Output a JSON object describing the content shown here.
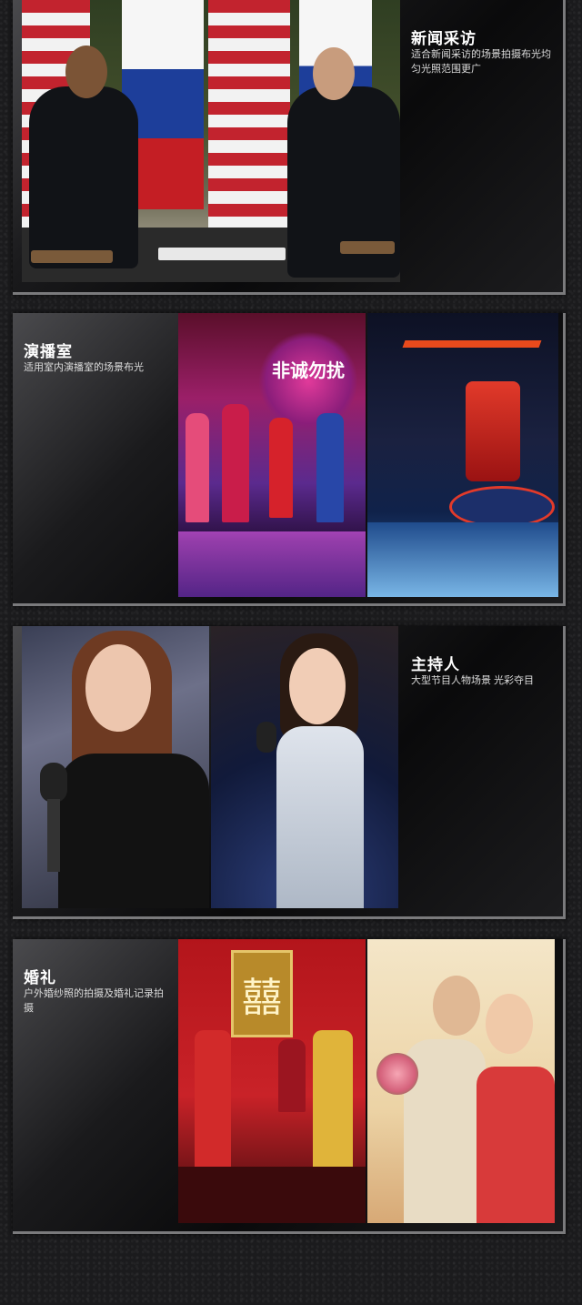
{
  "sections": [
    {
      "title": "新闻采访",
      "desc": "适合新闻采访的场景拍摄布光均匀光照范围更广"
    },
    {
      "title": "演播室",
      "desc": "适用室内演播室的场景布光"
    },
    {
      "title": "主持人",
      "desc": "大型节目人物场景 光彩夺目"
    },
    {
      "title": "婚礼",
      "desc": "户外婚纱照的拍摄及婚礼记录拍摄"
    }
  ],
  "photo_text": {
    "wedding_symbol": "囍",
    "studio_sign": "非诚勿扰"
  }
}
